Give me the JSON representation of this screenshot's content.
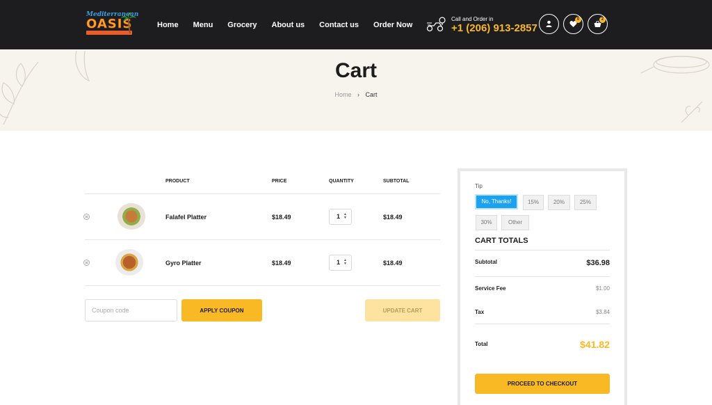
{
  "header": {
    "logo": {
      "script": "Mediterranean",
      "brand": "OASIS"
    },
    "nav": [
      "Home",
      "Menu",
      "Grocery",
      "About us",
      "Contact us",
      "Order Now"
    ],
    "call_label": "Call and Order in",
    "phone": "+1 (206) 913-2857",
    "wishlist_count": "0",
    "cart_count": "2"
  },
  "hero": {
    "title": "Cart",
    "breadcrumb_home": "Home",
    "breadcrumb_sep": "›",
    "breadcrumb_current": "Cart"
  },
  "table": {
    "headers": {
      "product": "PRODUCT",
      "price": "PRICE",
      "quantity": "QUANTITY",
      "subtotal": "SUBTOTAL"
    },
    "rows": [
      {
        "name": "Falafel Platter",
        "price": "$18.49",
        "qty": "1",
        "subtotal": "$18.49"
      },
      {
        "name": "Gyro Platter",
        "price": "$18.49",
        "qty": "1",
        "subtotal": "$18.49"
      }
    ]
  },
  "coupon": {
    "placeholder": "Coupon code",
    "apply_label": "APPLY COUPON",
    "update_label": "UPDATE CART"
  },
  "totals": {
    "tip_label": "Tip",
    "tips": [
      "No, Thanks!",
      "15%",
      "20%",
      "25%",
      "30%",
      "Other"
    ],
    "title": "CART TOTALS",
    "subtotal_label": "Subtotal",
    "subtotal": "$36.98",
    "fee_label": "Service Fee",
    "fee": "$1.00",
    "tax_label": "Tax",
    "tax": "$3.84",
    "total_label": "Total",
    "total": "$41.82",
    "checkout_label": "PROCEED TO CHECKOUT"
  },
  "colors": {
    "accent": "#f9b925",
    "header_bg": "#1d1d1f",
    "hero_bg": "#f7f4ee",
    "tip_active": "#1da1f2"
  }
}
